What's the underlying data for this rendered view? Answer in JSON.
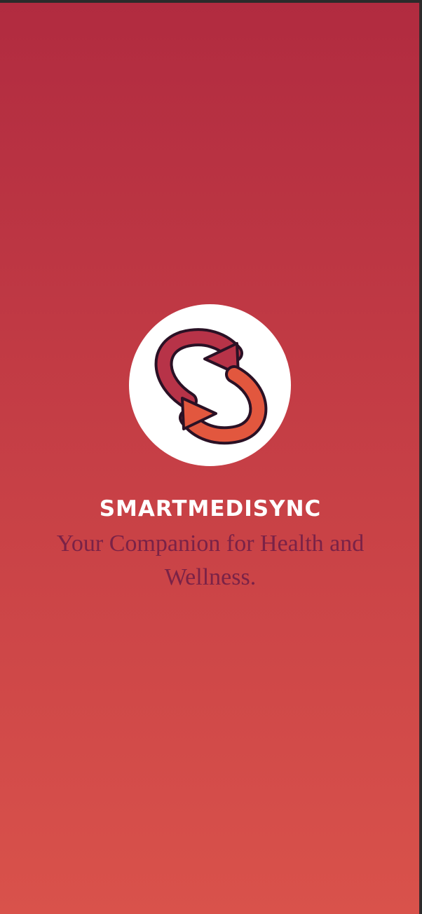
{
  "app": {
    "name": "SMARTMEDISYNC",
    "tagline": "Your Companion for Health and Wellness."
  },
  "logo": {
    "icon": "sync-arrows-icon"
  },
  "colors": {
    "gradient_top": "#b12b40",
    "gradient_bottom": "#d9524b",
    "tagline": "#7a2247",
    "arrow_top": "#b73348",
    "arrow_bottom": "#e2573e",
    "outline": "#2a1125"
  }
}
